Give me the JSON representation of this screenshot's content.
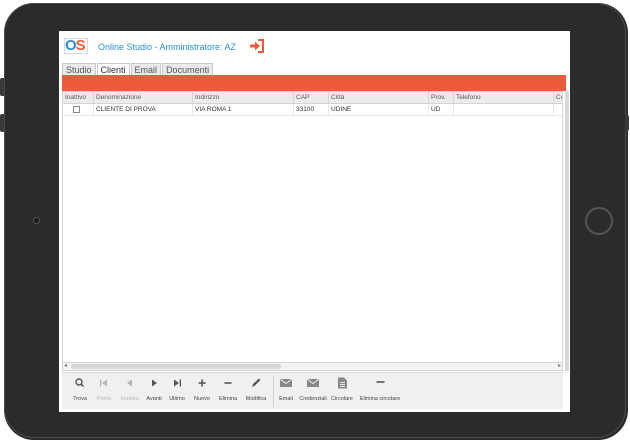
{
  "app": {
    "logo_o": "O",
    "logo_s": "S",
    "title": "Online Studio - Amministratore: AZ",
    "accent": "#f05a3c",
    "brand": "#2b8fd6"
  },
  "tabs": [
    {
      "label": "Studio"
    },
    {
      "label": "Clienti"
    },
    {
      "label": "Email"
    },
    {
      "label": "Documenti"
    }
  ],
  "grid": {
    "columns": [
      "Inattivo",
      "Denominazione",
      "Indirizzo",
      "CAP",
      "Città",
      "Prov.",
      "Telefono",
      "Ce"
    ],
    "rows": [
      {
        "inattivo": false,
        "denominazione": "CLIENTE DI PROVA",
        "indirizzo": "VIA ROMA 1",
        "cap": "33100",
        "citta": "UDINE",
        "prov": "UD",
        "telefono": "",
        "extra": ""
      }
    ]
  },
  "toolbar": {
    "trova": "Trova",
    "primo": "Primo",
    "indietro": "Indietro",
    "avanti": "Avanti",
    "ultimo": "Ultimo",
    "nuovo": "Nuovo",
    "elimina": "Elimina",
    "modifica": "Modifica",
    "email": "Email",
    "credenziali": "Credenziali",
    "circolare": "Circolare",
    "elimina_circolare": "Elimina circolare"
  }
}
